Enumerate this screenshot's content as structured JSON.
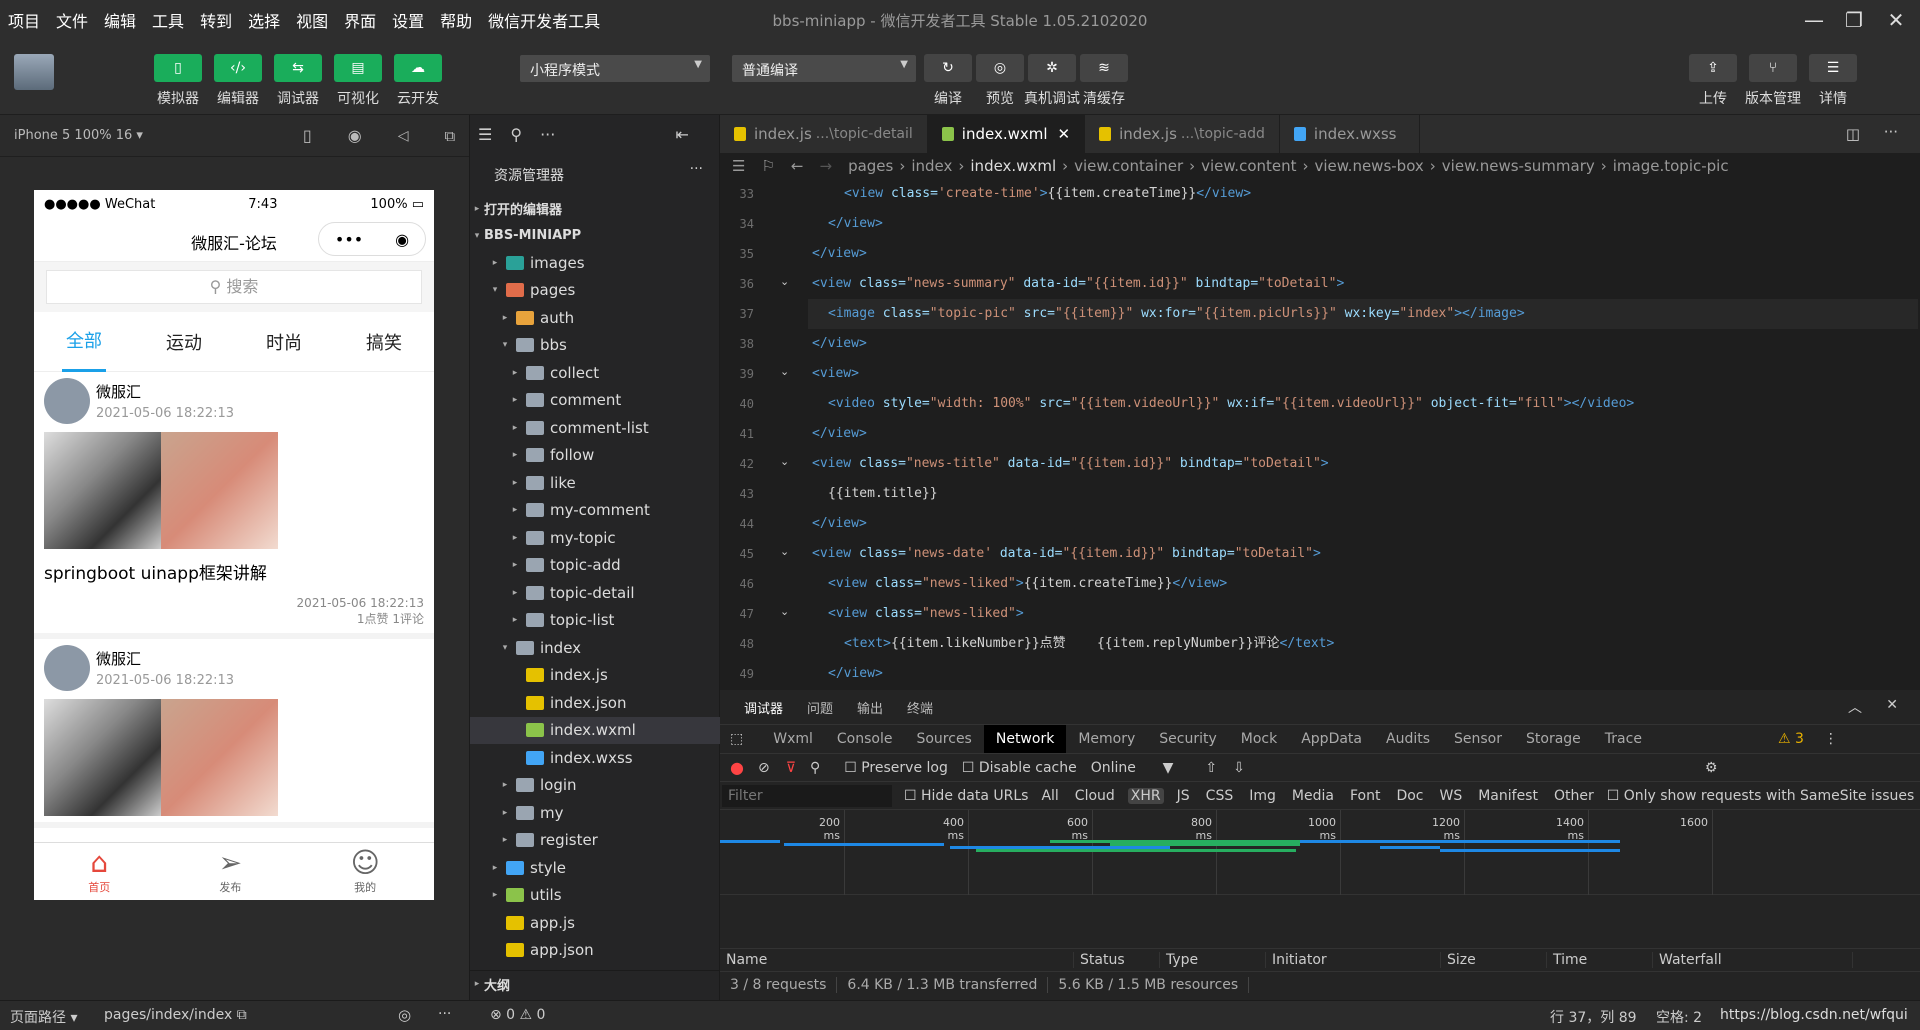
{
  "menu": [
    "项目",
    "文件",
    "编辑",
    "工具",
    "转到",
    "选择",
    "视图",
    "界面",
    "设置",
    "帮助",
    "微信开发者工具"
  ],
  "window_title": "bbs-miniapp - 微信开发者工具 Stable 1.05.2102020",
  "toolbar": {
    "left_buttons": [
      {
        "label": "模拟器",
        "icon": "phone-icon"
      },
      {
        "label": "编辑器",
        "icon": "code-icon"
      },
      {
        "label": "调试器",
        "icon": "debug-icon"
      },
      {
        "label": "可视化",
        "icon": "layout-icon"
      },
      {
        "label": "云开发",
        "icon": "cloud-icon"
      }
    ],
    "mode_select": "小程序模式",
    "compile_select": "普通编译",
    "mid_buttons": [
      {
        "label": "编译",
        "icon": "refresh-icon"
      },
      {
        "label": "预览",
        "icon": "eye-icon"
      },
      {
        "label": "真机调试",
        "icon": "bug-icon"
      },
      {
        "label": "清缓存",
        "icon": "layers-icon"
      }
    ],
    "right_buttons": [
      {
        "label": "上传",
        "icon": "upload-icon"
      },
      {
        "label": "版本管理",
        "icon": "branch-icon"
      },
      {
        "label": "详情",
        "icon": "menu-icon"
      }
    ]
  },
  "simulator": {
    "device": "iPhone 5 100% 16 ▾",
    "status": {
      "carrier": "●●●●● WeChat",
      "time": "7:43",
      "battery": "100%"
    },
    "nav_title": "微服汇-论坛",
    "search_placeholder": "搜索",
    "tabs": [
      "全部",
      "运动",
      "时尚",
      "搞笑"
    ],
    "posts": [
      {
        "author": "微服汇",
        "date": "2021-05-06 18:22:13",
        "title": "springboot uinapp框架讲解",
        "time": "2021-05-06 18:22:13",
        "stats": "1点赞 1评论"
      },
      {
        "author": "微服汇",
        "date": "2021-05-06 18:22:13"
      }
    ],
    "tabbar": [
      {
        "label": "首页",
        "icon": "home-icon"
      },
      {
        "label": "发布",
        "icon": "send-icon"
      },
      {
        "label": "我的",
        "icon": "user-icon"
      }
    ]
  },
  "explorer": {
    "header": "资源管理器",
    "open_editors": "打开的编辑器",
    "project": "BBS-MINIAPP",
    "outline": "大纲",
    "items": [
      {
        "label": "images",
        "depth": 1,
        "arrow": "▸",
        "color": "#2aa198"
      },
      {
        "label": "pages",
        "depth": 1,
        "arrow": "▾",
        "color": "#e06c4a"
      },
      {
        "label": "auth",
        "depth": 2,
        "arrow": "▸",
        "color": "#e8a33c"
      },
      {
        "label": "bbs",
        "depth": 2,
        "arrow": "▾",
        "color": "#9aa5b1"
      },
      {
        "label": "collect",
        "depth": 3,
        "arrow": "▸",
        "color": "#9aa5b1"
      },
      {
        "label": "comment",
        "depth": 3,
        "arrow": "▸",
        "color": "#9aa5b1"
      },
      {
        "label": "comment-list",
        "depth": 3,
        "arrow": "▸",
        "color": "#9aa5b1"
      },
      {
        "label": "follow",
        "depth": 3,
        "arrow": "▸",
        "color": "#9aa5b1"
      },
      {
        "label": "like",
        "depth": 3,
        "arrow": "▸",
        "color": "#9aa5b1"
      },
      {
        "label": "my-comment",
        "depth": 3,
        "arrow": "▸",
        "color": "#9aa5b1"
      },
      {
        "label": "my-topic",
        "depth": 3,
        "arrow": "▸",
        "color": "#9aa5b1"
      },
      {
        "label": "topic-add",
        "depth": 3,
        "arrow": "▸",
        "color": "#9aa5b1"
      },
      {
        "label": "topic-detail",
        "depth": 3,
        "arrow": "▸",
        "color": "#9aa5b1"
      },
      {
        "label": "topic-list",
        "depth": 3,
        "arrow": "▸",
        "color": "#9aa5b1"
      },
      {
        "label": "index",
        "depth": 2,
        "arrow": "▾",
        "color": "#9aa5b1"
      },
      {
        "label": "index.js",
        "depth": 3,
        "arrow": "",
        "color": "#e5c100"
      },
      {
        "label": "index.json",
        "depth": 3,
        "arrow": "",
        "color": "#e5c100"
      },
      {
        "label": "index.wxml",
        "depth": 3,
        "arrow": "",
        "color": "#8bc34a"
      },
      {
        "label": "index.wxss",
        "depth": 3,
        "arrow": "",
        "color": "#42a5f5"
      },
      {
        "label": "login",
        "depth": 2,
        "arrow": "▸",
        "color": "#9aa5b1"
      },
      {
        "label": "my",
        "depth": 2,
        "arrow": "▸",
        "color": "#9aa5b1"
      },
      {
        "label": "register",
        "depth": 2,
        "arrow": "▸",
        "color": "#9aa5b1"
      },
      {
        "label": "style",
        "depth": 1,
        "arrow": "▸",
        "color": "#42a5f5"
      },
      {
        "label": "utils",
        "depth": 1,
        "arrow": "▸",
        "color": "#8bc34a"
      },
      {
        "label": "app.js",
        "depth": 1,
        "arrow": "",
        "color": "#e5c100"
      },
      {
        "label": "app.json",
        "depth": 1,
        "arrow": "",
        "color": "#e5c100"
      }
    ]
  },
  "editor": {
    "tabs": [
      {
        "label": "index.js",
        "hint": "...\\topic-detail",
        "color": "#e5c100"
      },
      {
        "label": "index.wxml",
        "hint": "",
        "color": "#8bc34a",
        "active": true
      },
      {
        "label": "index.js",
        "hint": "...\\topic-add",
        "color": "#e5c100"
      },
      {
        "label": "index.wxss",
        "hint": "",
        "color": "#42a5f5"
      }
    ],
    "breadcrumb": [
      "pages",
      "index",
      "index.wxml",
      "view.container",
      "view.content",
      "view.news-box",
      "view.news-summary",
      "image.topic-pic"
    ],
    "lines": [
      {
        "n": "33",
        "fold": "",
        "indent": 2,
        "parts": [
          [
            "t-tag",
            "<view "
          ],
          [
            "t-attr",
            "class="
          ],
          [
            "t-str",
            "'create-time'"
          ],
          [
            "t-tag",
            ">"
          ],
          [
            "t-txt",
            "{{item.createTime}}"
          ],
          [
            "t-tag",
            "</view>"
          ]
        ]
      },
      {
        "n": "34",
        "fold": "",
        "indent": 1,
        "parts": [
          [
            "t-tag",
            "</view>"
          ]
        ]
      },
      {
        "n": "35",
        "fold": "",
        "indent": 0,
        "parts": [
          [
            "t-tag",
            "</view>"
          ]
        ]
      },
      {
        "n": "36",
        "fold": "⌄",
        "indent": 0,
        "parts": [
          [
            "t-tag",
            "<view "
          ],
          [
            "t-attr",
            "class="
          ],
          [
            "t-str",
            "\"news-summary\""
          ],
          [
            "t-attr",
            " data-id="
          ],
          [
            "t-str",
            "\"{{item.id}}\""
          ],
          [
            "t-attr",
            " bindtap="
          ],
          [
            "t-str",
            "\"toDetail\""
          ],
          [
            "t-tag",
            ">"
          ]
        ]
      },
      {
        "n": "37",
        "fold": "",
        "indent": 1,
        "parts": [
          [
            "t-tag",
            "<image "
          ],
          [
            "t-attr",
            "class="
          ],
          [
            "t-str",
            "\"topic-pic\""
          ],
          [
            "t-attr",
            " src="
          ],
          [
            "t-str",
            "\"{{item}}\""
          ],
          [
            "t-attr",
            " wx:for="
          ],
          [
            "t-str",
            "\"{{item.picUrls}}\""
          ],
          [
            "t-attr",
            " wx:key="
          ],
          [
            "t-str",
            "\"index\""
          ],
          [
            "t-tag",
            "></image>"
          ]
        ]
      },
      {
        "n": "38",
        "fold": "",
        "indent": 0,
        "parts": [
          [
            "t-tag",
            "</view>"
          ]
        ]
      },
      {
        "n": "39",
        "fold": "⌄",
        "indent": 0,
        "parts": [
          [
            "t-tag",
            "<view>"
          ]
        ]
      },
      {
        "n": "40",
        "fold": "",
        "indent": 1,
        "parts": [
          [
            "t-tag",
            "<video "
          ],
          [
            "t-attr",
            "style="
          ],
          [
            "t-str",
            "\"width: 100%\""
          ],
          [
            "t-attr",
            " src="
          ],
          [
            "t-str",
            "\"{{item.videoUrl}}\""
          ],
          [
            "t-attr",
            " wx:if="
          ],
          [
            "t-str",
            "\"{{item.videoUrl}}\""
          ],
          [
            "t-attr",
            " object-fit="
          ],
          [
            "t-str",
            "\"fill\""
          ],
          [
            "t-tag",
            "></video>"
          ]
        ]
      },
      {
        "n": "41",
        "fold": "",
        "indent": 0,
        "parts": [
          [
            "t-tag",
            "</view>"
          ]
        ]
      },
      {
        "n": "42",
        "fold": "⌄",
        "indent": 0,
        "parts": [
          [
            "t-tag",
            "<view "
          ],
          [
            "t-attr",
            "class="
          ],
          [
            "t-str",
            "\"news-title\""
          ],
          [
            "t-attr",
            " data-id="
          ],
          [
            "t-str",
            "\"{{item.id}}\""
          ],
          [
            "t-attr",
            " bindtap="
          ],
          [
            "t-str",
            "\"toDetail\""
          ],
          [
            "t-tag",
            ">"
          ]
        ]
      },
      {
        "n": "43",
        "fold": "",
        "indent": 1,
        "parts": [
          [
            "t-txt",
            "{{item.title}}"
          ]
        ]
      },
      {
        "n": "44",
        "fold": "",
        "indent": 0,
        "parts": [
          [
            "t-tag",
            "</view>"
          ]
        ]
      },
      {
        "n": "45",
        "fold": "⌄",
        "indent": 0,
        "parts": [
          [
            "t-tag",
            "<view "
          ],
          [
            "t-attr",
            "class="
          ],
          [
            "t-str",
            "'news-date'"
          ],
          [
            "t-attr",
            " data-id="
          ],
          [
            "t-str",
            "\"{{item.id}}\""
          ],
          [
            "t-attr",
            " bindtap="
          ],
          [
            "t-str",
            "\"toDetail\""
          ],
          [
            "t-tag",
            ">"
          ]
        ]
      },
      {
        "n": "46",
        "fold": "",
        "indent": 1,
        "parts": [
          [
            "t-tag",
            "<view "
          ],
          [
            "t-attr",
            "class="
          ],
          [
            "t-str",
            "\"news-liked\""
          ],
          [
            "t-tag",
            ">"
          ],
          [
            "t-txt",
            "{{item.createTime}}"
          ],
          [
            "t-tag",
            "</view>"
          ]
        ]
      },
      {
        "n": "47",
        "fold": "⌄",
        "indent": 1,
        "parts": [
          [
            "t-tag",
            "<view "
          ],
          [
            "t-attr",
            "class="
          ],
          [
            "t-str",
            "\"news-liked\""
          ],
          [
            "t-tag",
            ">"
          ]
        ]
      },
      {
        "n": "48",
        "fold": "",
        "indent": 2,
        "parts": [
          [
            "t-tag",
            "<text>"
          ],
          [
            "t-txt",
            "{{item.likeNumber}}点赞    {{item.replyNumber}}评论"
          ],
          [
            "t-tag",
            "</text>"
          ]
        ]
      },
      {
        "n": "49",
        "fold": "",
        "indent": 1,
        "parts": [
          [
            "t-tag",
            "</view>"
          ]
        ]
      }
    ]
  },
  "devtools": {
    "top_tabs": [
      "调试器",
      "问题",
      "输出",
      "终端"
    ],
    "tabs": [
      "Wxml",
      "Console",
      "Sources",
      "Network",
      "Memory",
      "Security",
      "Mock",
      "AppData",
      "Audits",
      "Sensor",
      "Storage",
      "Trace"
    ],
    "active_tab": "Network",
    "warnings": "3",
    "preserve_log": "Preserve log",
    "disable_cache": "Disable cache",
    "throttle": "Online",
    "filter_placeholder": "Filter",
    "hide_data_urls": "Hide data URLs",
    "types": [
      "All",
      "Cloud",
      "XHR",
      "JS",
      "CSS",
      "Img",
      "Media",
      "Font",
      "Doc",
      "WS",
      "Manifest",
      "Other"
    ],
    "active_type": "XHR",
    "samesite": "Only show requests with SameSite issues",
    "ticks": [
      "200 ms",
      "400 ms",
      "600 ms",
      "800 ms",
      "1000 ms",
      "1200 ms",
      "1400 ms",
      "1600"
    ],
    "columns": [
      "Name",
      "Status",
      "Type",
      "Initiator",
      "Size",
      "Time",
      "Waterfall"
    ],
    "summary": [
      "3 / 8 requests",
      "6.4 KB / 1.3 MB transferred",
      "5.6 KB / 1.5 MB resources"
    ]
  },
  "statusbar": {
    "path_label": "页面路径 ▾",
    "path": "pages/index/index",
    "errors": "⊗ 0 ⚠ 0",
    "cursor": "行 37，列 89",
    "spaces": "空格: 2",
    "watermark": "https://blog.csdn.net/wfqui"
  }
}
